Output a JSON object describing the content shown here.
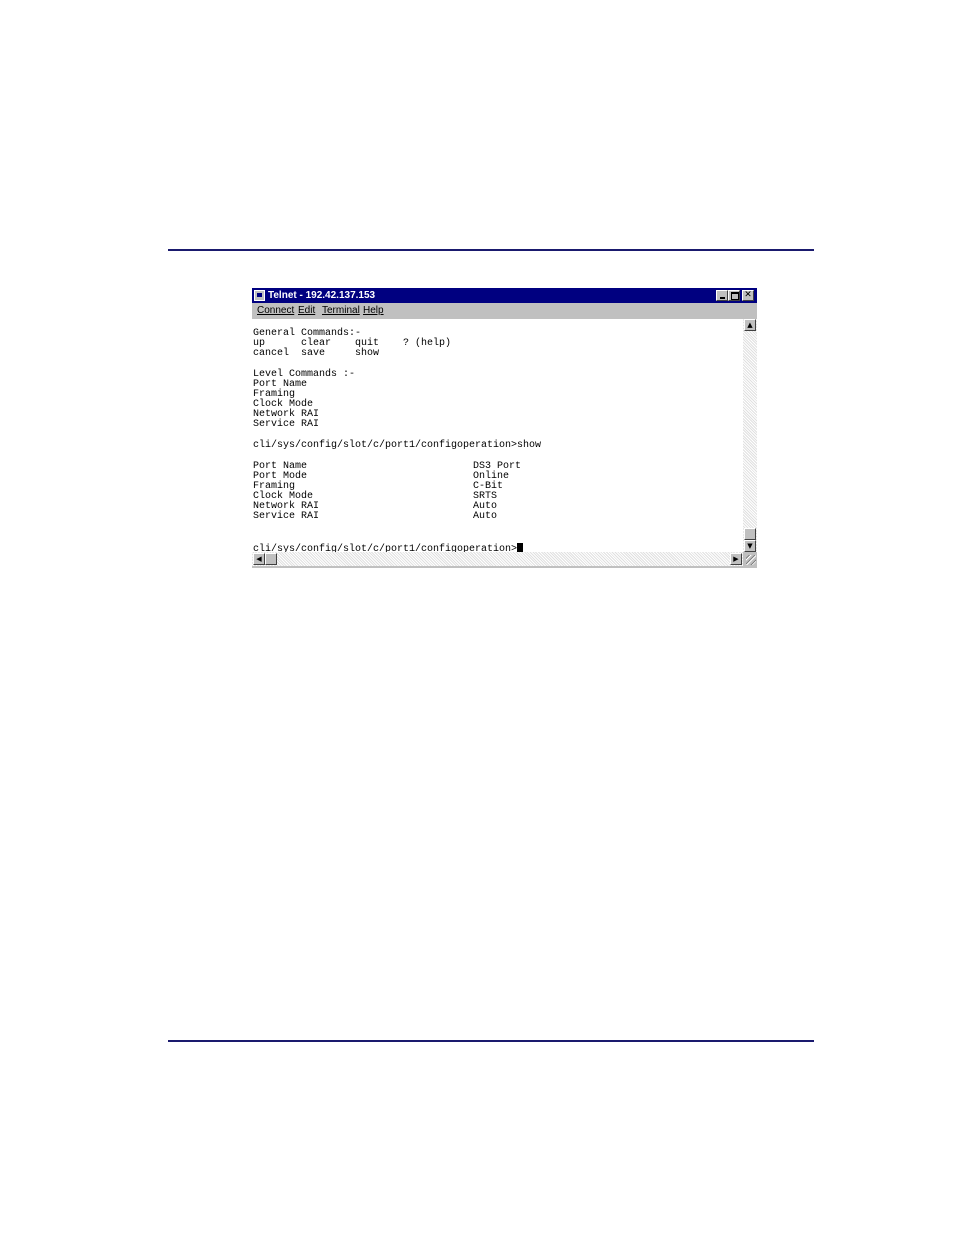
{
  "window": {
    "title": "Telnet - 192.42.137.153",
    "menu": [
      "Connect",
      "Edit",
      "Terminal",
      "Help"
    ]
  },
  "terminal": {
    "general_header": "General Commands:-",
    "general_row1": "up      clear    quit    ? (help)",
    "general_row2": "cancel  save     show",
    "level_header": "Level Commands :-",
    "level_items": [
      "Port Name",
      "Framing",
      "Clock Mode",
      "Network RAI",
      "Service RAI"
    ],
    "command_line": "cli/sys/config/slot/c/port1/configoperation>show",
    "show_rows": [
      {
        "label": "Port Name",
        "value": "DS3 Port"
      },
      {
        "label": "Port Mode",
        "value": "Online"
      },
      {
        "label": "Framing",
        "value": "C-Bit"
      },
      {
        "label": "Clock Mode",
        "value": "SRTS"
      },
      {
        "label": "Network RAI",
        "value": "Auto"
      },
      {
        "label": "Service RAI",
        "value": "Auto"
      }
    ],
    "prompt": "cli/sys/config/slot/c/port1/configoperation>"
  },
  "colors": {
    "titlebar": "#000080",
    "rule": "#1a1a6e",
    "chrome": "#c0c0c0"
  }
}
